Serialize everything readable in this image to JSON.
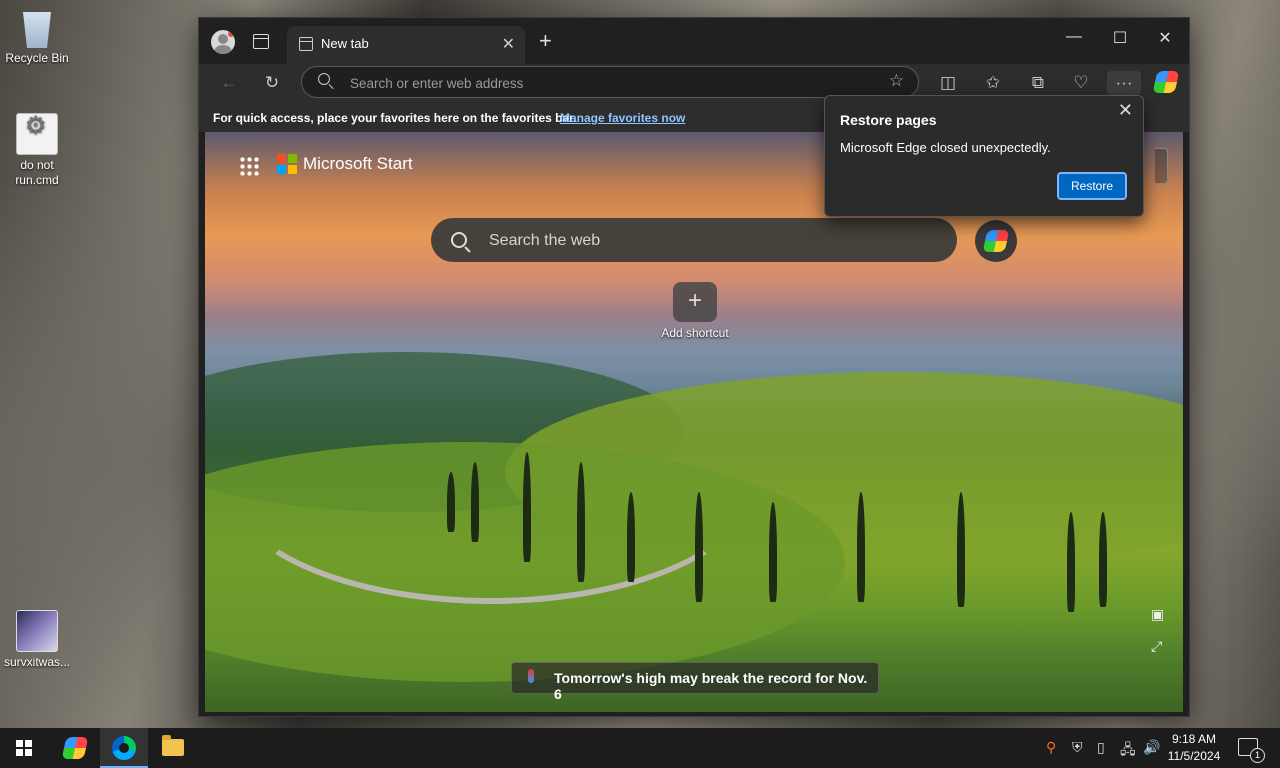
{
  "desktop": {
    "icons": [
      {
        "label": "Recycle Bin"
      },
      {
        "label": "do not run.cmd"
      },
      {
        "label": "survxitwas..."
      }
    ]
  },
  "browser": {
    "tab": {
      "title": "New tab"
    },
    "address": {
      "placeholder": "Search or enter web address"
    },
    "favorites_bar": {
      "message": "For quick access, place your favorites here on the favorites bar.",
      "link": "Manage favorites now"
    },
    "newtab": {
      "brand": "Microsoft Start",
      "search_placeholder": "Search the web",
      "add_shortcut": "Add shortcut",
      "news_headline": "Tomorrow's high may break the record for Nov. 6"
    },
    "restore_popup": {
      "title": "Restore pages",
      "message": "Microsoft Edge closed unexpectedly.",
      "button": "Restore"
    }
  },
  "taskbar": {
    "time": "9:18 AM",
    "date": "11/5/2024",
    "notification_count": "1"
  },
  "colors": {
    "accent": "#0067c0",
    "link": "#8fc6ff",
    "ms_logo": [
      "#f25022",
      "#7fba00",
      "#00a4ef",
      "#ffb900"
    ]
  }
}
